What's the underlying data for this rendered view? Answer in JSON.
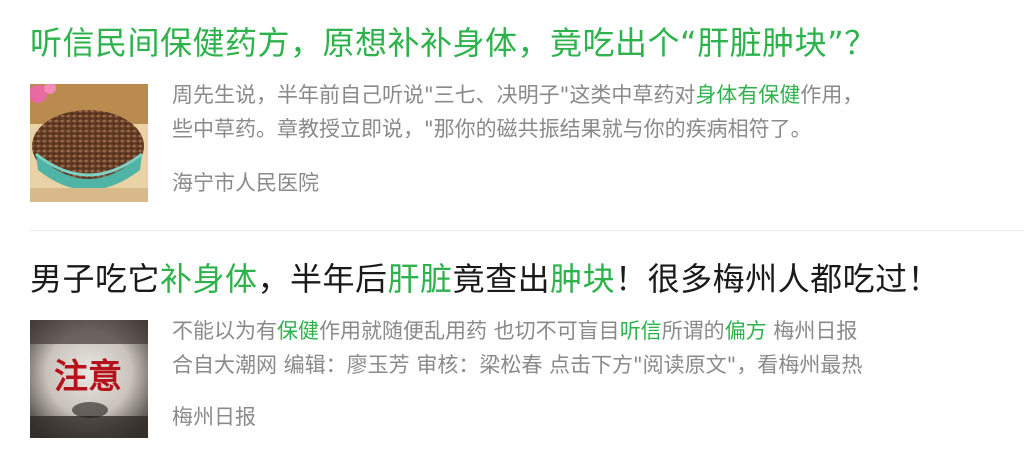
{
  "results": [
    {
      "title": {
        "part1": "听信民间保健药方，原想补补身体，竟吃出个“肝脏肿块”？"
      },
      "snippet": {
        "line1_a": "周先生说，半年前自己听说\"三七、决明子\"这类中草药对",
        "line1_hl": "身体有保健",
        "line1_b": "作用，",
        "line2": "些中草药。章教授立即说，\"那你的磁共振结果就与你的疾病相符了。"
      },
      "source": "海宁市人民医院",
      "thumb_icon": "seeds-bowl-image"
    },
    {
      "title": {
        "t1": "男子吃它",
        "t2": "补身体",
        "t3": "，半年后",
        "t4": "肝脏",
        "t5": "竟查出",
        "t6": "肿块",
        "t7": "！很多梅州人都吃过！"
      },
      "snippet": {
        "line1_a": "不能以为有",
        "line1_hl1": "保健",
        "line1_b": "作用就随便乱用药 也切不可盲目",
        "line1_hl2": "听信",
        "line1_c": "所谓的",
        "line1_hl3": "偏方",
        "line1_d": " 梅州日报",
        "line2": "合自大潮网 编辑：廖玉芳 审核：梁松春 点击下方\"阅读原文\"，看梅州最热"
      },
      "source": "梅州日报",
      "thumb_text": "注意",
      "thumb_icon": "warning-notice-image"
    }
  ],
  "colors": {
    "accent": "#2eb24c",
    "title_dark": "#1a1a1a",
    "muted": "#8a8a8a"
  }
}
